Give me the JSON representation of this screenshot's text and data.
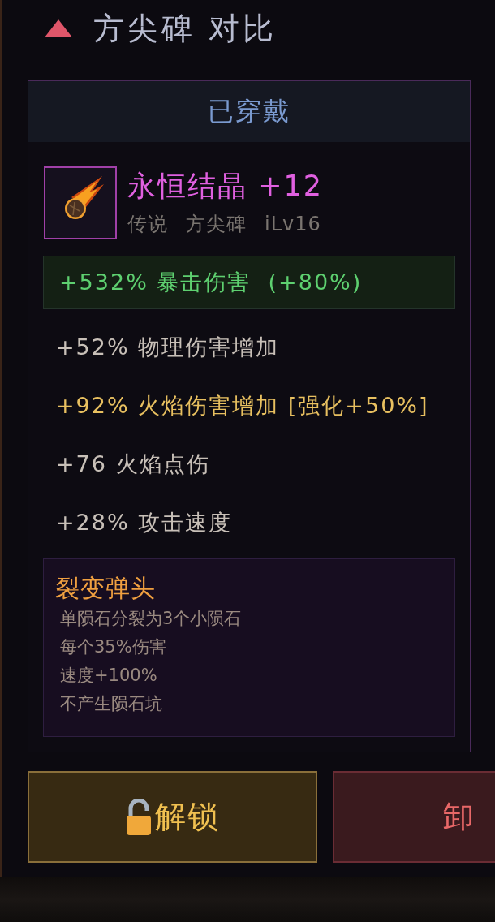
{
  "header": {
    "title": "方尖碑 对比",
    "expanded": true
  },
  "card": {
    "status": "已穿戴",
    "item": {
      "name": "永恒结晶 +12",
      "rarity": "传说",
      "type": "方尖碑",
      "level": "iLv16"
    },
    "stats": [
      {
        "kind": "highlight",
        "text": "+532% 暴击伤害  (+80%)"
      },
      {
        "kind": "normal",
        "text": "+52% 物理伤害增加"
      },
      {
        "kind": "enhanced",
        "text": "+92% 火焰伤害增加 [强化+50%]"
      },
      {
        "kind": "normal",
        "text": "+76 火焰点伤"
      },
      {
        "kind": "normal",
        "text": "+28% 攻击速度"
      }
    ],
    "special": {
      "title": "裂变弹头",
      "lines": [
        "单陨石分裂为3个小陨石",
        "每个35%伤害",
        "速度+100%",
        "不产生陨石坑"
      ]
    }
  },
  "buttons": [
    {
      "kind": "unlock",
      "label": "解锁"
    },
    {
      "kind": "unequip",
      "label": "卸"
    }
  ]
}
